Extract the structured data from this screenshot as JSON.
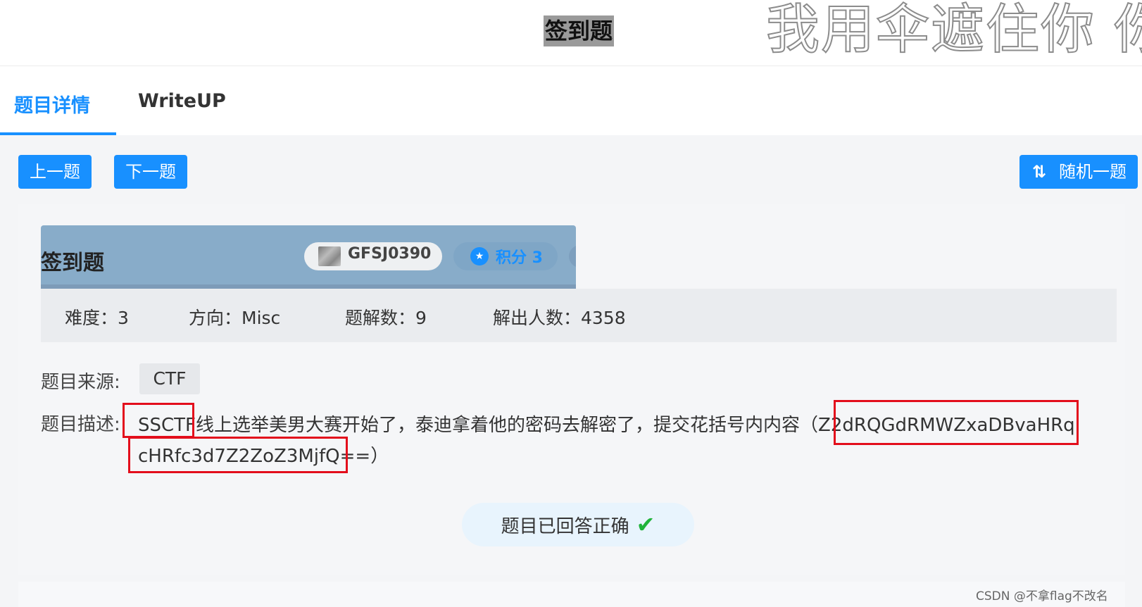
{
  "header": {
    "title": "签到题",
    "watermark": "我用伞遮住你 你"
  },
  "tabs": [
    {
      "label": "题目详情",
      "active": true
    },
    {
      "label": "WriteUP",
      "active": false
    }
  ],
  "toolbar": {
    "prev_label": "上一题",
    "next_label": "下一题",
    "random_label": "随机一题",
    "random_icon": "⇅"
  },
  "challenge": {
    "title": "签到题",
    "code": "GFSJ0390",
    "score": "积分 3",
    "stats": {
      "difficulty": "难度：3",
      "direction": "方向：Misc",
      "solves": "题解数：9",
      "solvers": "解出人数：4358"
    },
    "source_label": "题目来源:",
    "source": "CTF",
    "desc_label": "题目描述:",
    "desc_prefix": "SSCTF",
    "desc_body": "线上选举美男大赛开始了，泰迪拿着他的密码去解密了，提交花括号内内容（",
    "cipher_part1": "Z2dRQGdRMWZxaDBvaHRq",
    "cipher_part2": "cHRfc3d7Z2ZoZ3MjfQ==",
    "desc_suffix": "）",
    "status": "题目已回答正确",
    "status_icon": "✔"
  },
  "footer": {
    "credit": "CSDN @不拿flag不改名"
  },
  "colors": {
    "accent": "#1890ff",
    "highlight": "#e30e1c",
    "success": "#1fb33a"
  }
}
